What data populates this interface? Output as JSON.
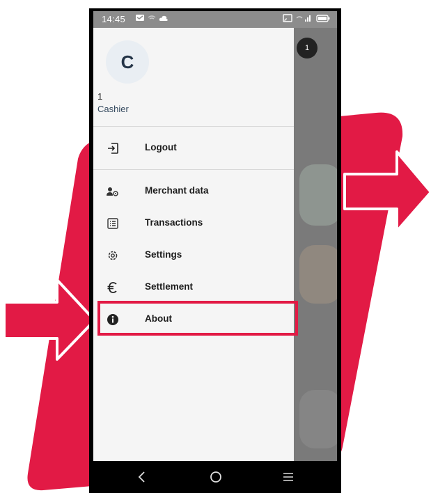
{
  "status_bar": {
    "time": "14:45"
  },
  "drawer": {
    "avatar_letter": "C",
    "user_id": "1",
    "user_role": "Cashier",
    "logout_label": "Logout",
    "items": [
      {
        "label": "Merchant data",
        "icon": "merchant-settings-icon"
      },
      {
        "label": "Transactions",
        "icon": "list-icon"
      },
      {
        "label": "Settings",
        "icon": "gear-icon"
      },
      {
        "label": "Settlement",
        "icon": "euro-icon"
      },
      {
        "label": "About",
        "icon": "info-icon"
      }
    ]
  },
  "background": {
    "badge_value": "1"
  },
  "navbar": {
    "back": "back-icon",
    "home": "home-icon",
    "menu": "menu-icon"
  },
  "colors": {
    "accent_red": "#e21a45",
    "drawer_bg": "#f5f5f5",
    "scrim": "#7a7a7a",
    "avatar_bg": "#e9eef3"
  }
}
